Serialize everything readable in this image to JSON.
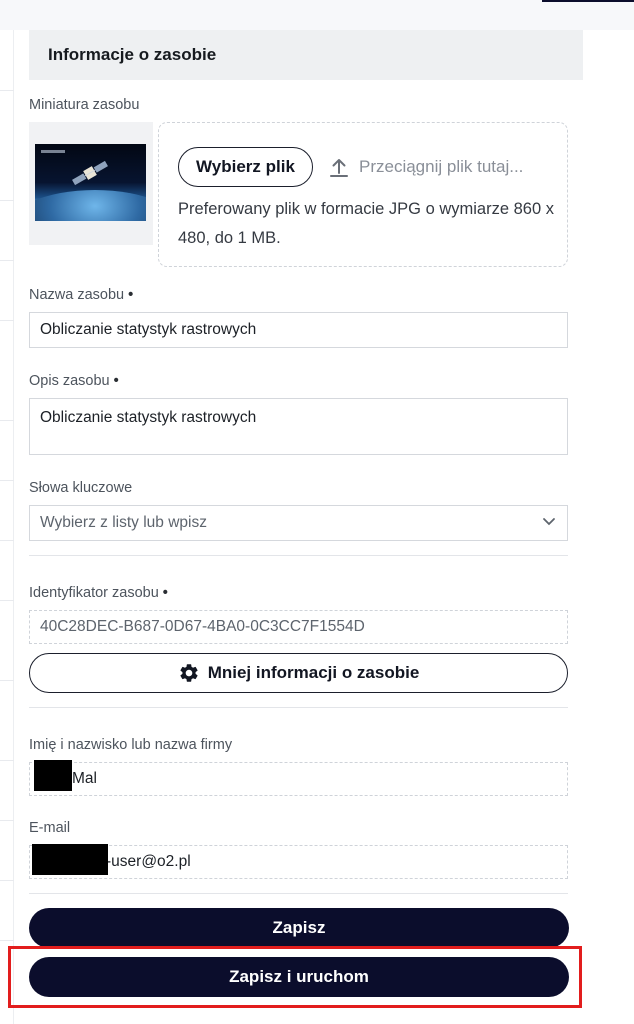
{
  "section": {
    "title": "Informacje o zasobie"
  },
  "thumbnail": {
    "label": "Miniatura zasobu",
    "choose_button": "Wybierz plik",
    "drag_text": "Przeciągnij plik tutaj...",
    "hint": "Preferowany plik w formacie JPG o wymiarze 860 x 480, do 1 MB."
  },
  "name": {
    "label": "Nazwa zasobu",
    "required": "•",
    "value": "Obliczanie statystyk rastrowych"
  },
  "description": {
    "label": "Opis zasobu",
    "required": "•",
    "value": "Obliczanie statystyk rastrowych"
  },
  "keywords": {
    "label": "Słowa kluczowe",
    "placeholder": "Wybierz z listy lub wpisz"
  },
  "identifier": {
    "label": "Identyfikator zasobu",
    "required": "•",
    "value": "40C28DEC-B687-0D67-4BA0-0C3CC7F1554D"
  },
  "toggle_button": {
    "label": "Mniej informacji o zasobie",
    "icon": "gear-icon"
  },
  "owner": {
    "label": "Imię i nazwisko lub nazwa firmy",
    "value_visible": "Mal"
  },
  "email": {
    "label": "E-mail",
    "value_visible": "-user@o2.pl"
  },
  "actions": {
    "save": "Zapisz",
    "save_and_run": "Zapisz i uruchom"
  },
  "colors": {
    "primary": "#0b0d2c",
    "highlight": "#e21d1d",
    "header_bg": "#eef0f2"
  }
}
